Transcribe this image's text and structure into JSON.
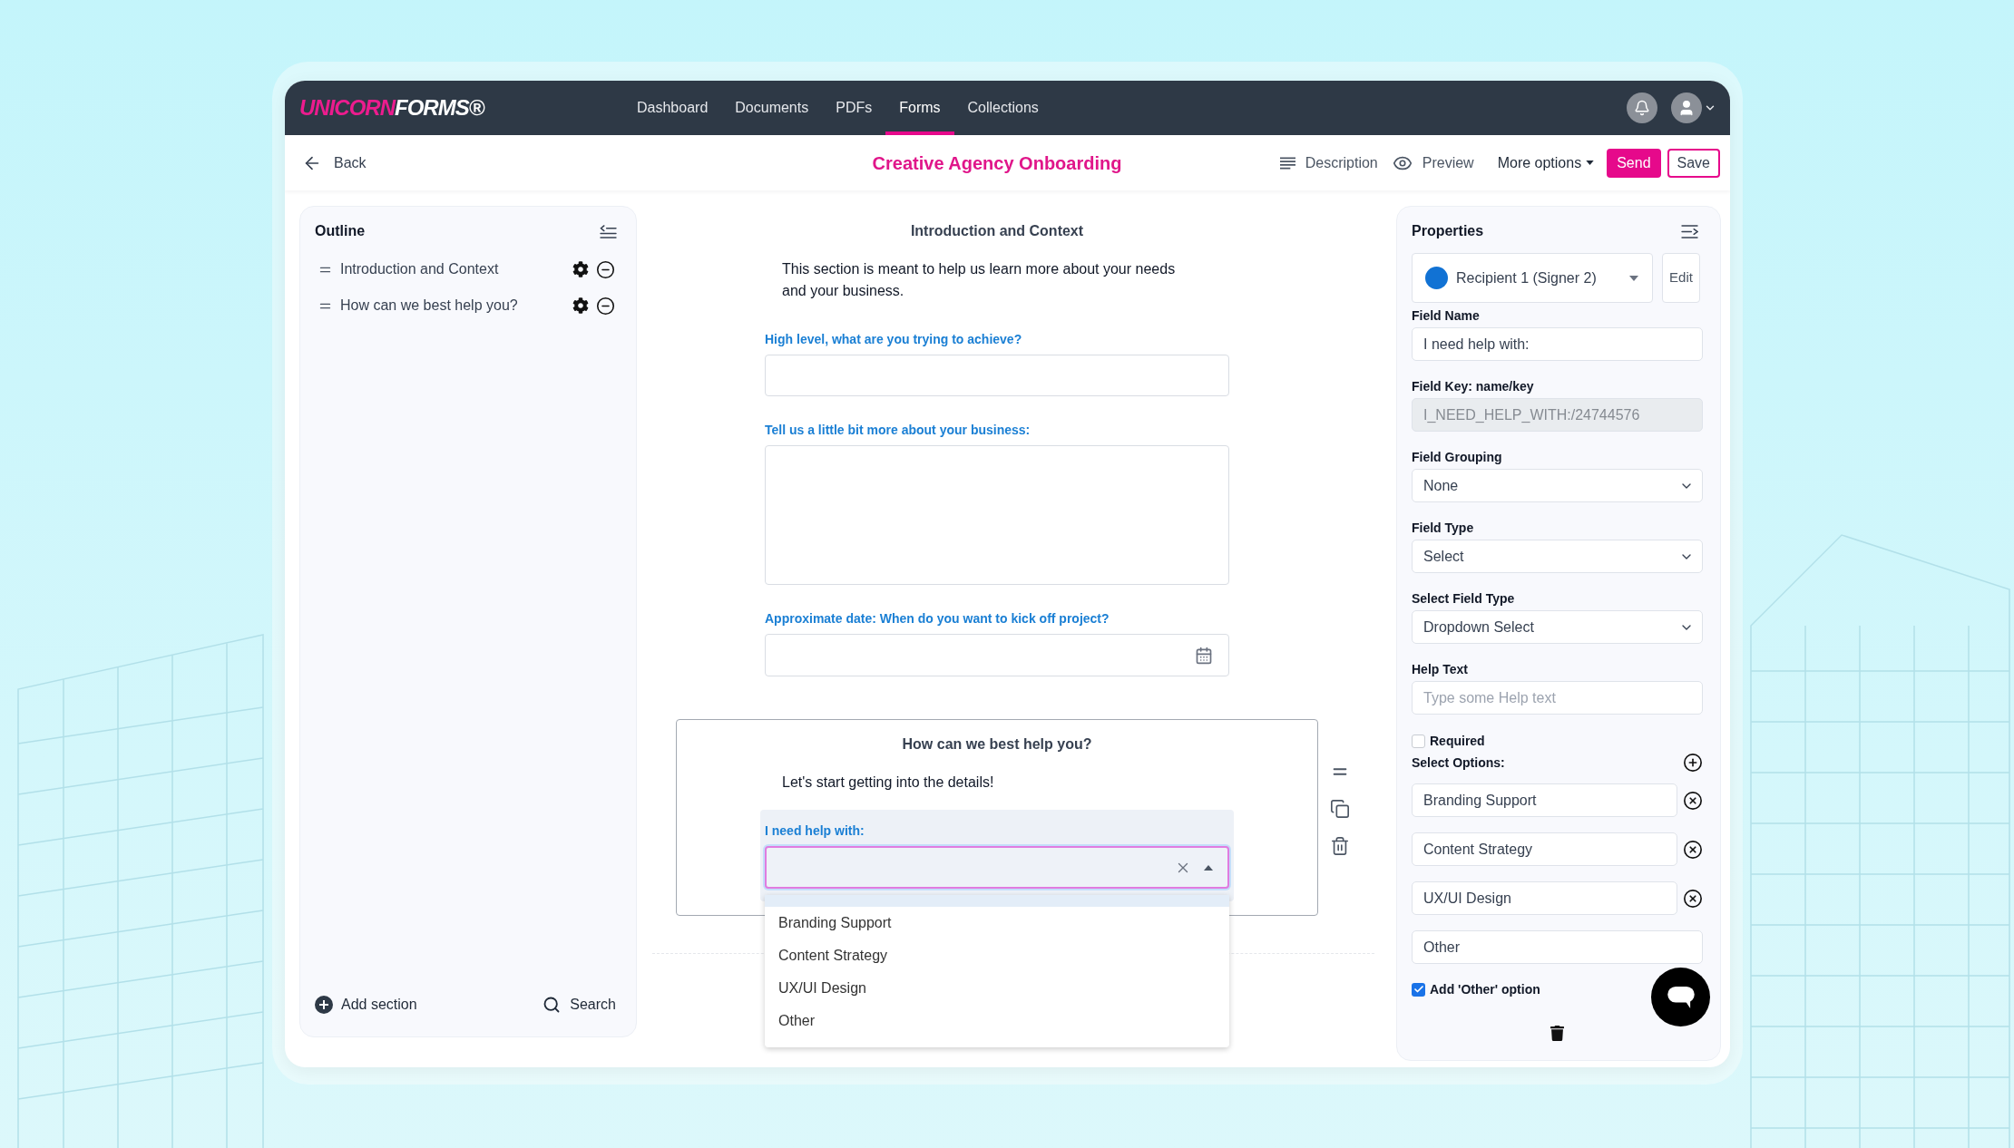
{
  "header": {
    "logo": {
      "accent": "UNICORN",
      "rest": "FORMS®"
    },
    "nav": [
      {
        "label": "Dashboard",
        "selected": false
      },
      {
        "label": "Documents",
        "selected": false
      },
      {
        "label": "PDFs",
        "selected": false
      },
      {
        "label": "Forms",
        "selected": true
      },
      {
        "label": "Collections",
        "selected": false
      }
    ]
  },
  "toolbar": {
    "back": "Back",
    "title": "Creative Agency Onboarding",
    "actions": [
      {
        "kind": "description",
        "label": "Description"
      },
      {
        "kind": "preview",
        "label": "Preview"
      },
      {
        "kind": "menu",
        "label": "More options"
      },
      {
        "kind": "primary",
        "label": "Send"
      },
      {
        "kind": "outline",
        "label": "Save"
      }
    ]
  },
  "outline": {
    "title": "Outline",
    "sections": [
      {
        "label": "Introduction and Context"
      },
      {
        "label": "How can we best help you?"
      }
    ],
    "add_section": "Add section",
    "search": "Search"
  },
  "form": {
    "sections": [
      {
        "title": "Introduction and Context",
        "description": "This section is meant to help us learn more about your needs and your business.",
        "selected": false,
        "fields": [
          {
            "kind": "text",
            "label": "High level, what are you trying to achieve?",
            "selected": false
          },
          {
            "kind": "textarea",
            "label": "Tell us a little bit more about your business:",
            "selected": false
          },
          {
            "kind": "date",
            "label": "Approximate date: When do you want to kick off project?",
            "selected": false
          }
        ]
      },
      {
        "title": "How can we best help you?",
        "description": "Let's start getting into the details!",
        "selected": true,
        "fields": [
          {
            "kind": "select",
            "label": "I need help with:",
            "selected": true,
            "open": true,
            "options": [
              "Branding Support",
              "Content Strategy",
              "UX/UI Design",
              "Other"
            ]
          }
        ]
      }
    ]
  },
  "properties": {
    "title": "Properties",
    "recipient": {
      "label": "Recipient 1 (Signer 2)",
      "color": "#1172d4"
    },
    "edit": "Edit",
    "fields": [
      {
        "kind": "input",
        "label": "Field Name",
        "value": "I need help with:",
        "disabled": false
      },
      {
        "kind": "input",
        "label": "Field Key: name/key",
        "value": "I_NEED_HELP_WITH:/24744576",
        "disabled": true
      },
      {
        "kind": "select",
        "label": "Field Grouping",
        "value": "None",
        "disabled": false
      },
      {
        "kind": "select",
        "label": "Field Type",
        "value": "Select",
        "disabled": false
      },
      {
        "kind": "select",
        "label": "Select Field Type",
        "value": "Dropdown Select",
        "disabled": false
      },
      {
        "kind": "input",
        "label": "Help Text",
        "placeholder": "Type some Help text",
        "disabled": false
      }
    ],
    "required": {
      "label": "Required",
      "checked": false
    },
    "options_label": "Select Options:",
    "options": [
      {
        "value": "Branding Support",
        "removable": true
      },
      {
        "value": "Content Strategy",
        "removable": true
      },
      {
        "value": "UX/UI Design",
        "removable": true
      },
      {
        "value": "Other",
        "removable": false
      }
    ],
    "add_other": {
      "label": "Add 'Other' option",
      "checked": true
    }
  }
}
